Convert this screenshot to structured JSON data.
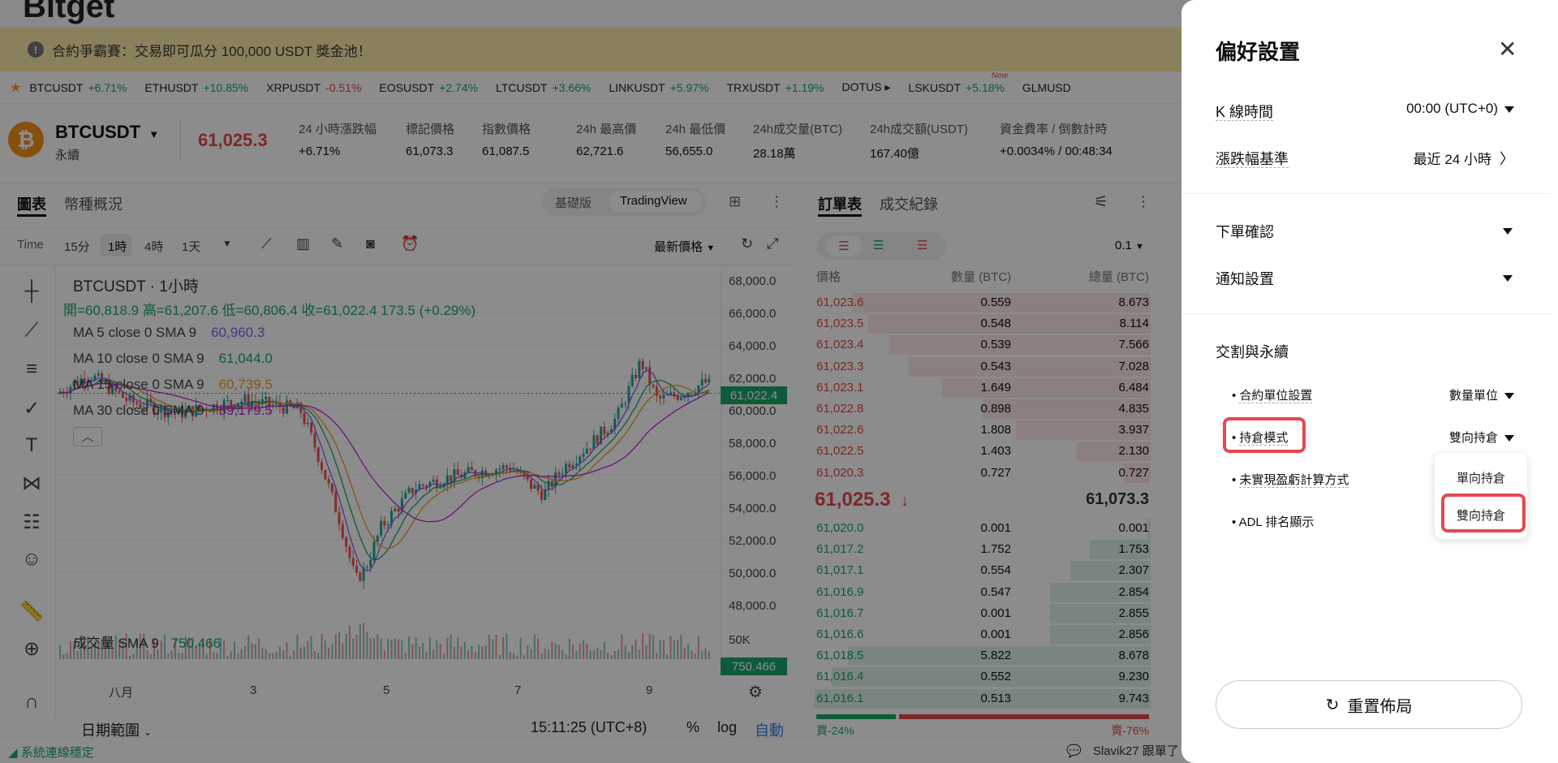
{
  "banner": {
    "text": "合約爭霸賽：交易即可瓜分 100,000 USDT 獎金池！"
  },
  "ticker": [
    {
      "pair": "BTCUSDT",
      "change": "+6.71%",
      "dir": "up"
    },
    {
      "pair": "ETHUSDT",
      "change": "+10.85%",
      "dir": "up"
    },
    {
      "pair": "XRPUSDT",
      "change": "-0.51%",
      "dir": "down"
    },
    {
      "pair": "EOSUSDT",
      "change": "+2.74%",
      "dir": "up"
    },
    {
      "pair": "LTCUSDT",
      "change": "+3.66%",
      "dir": "up"
    },
    {
      "pair": "LINKUSDT",
      "change": "+5.97%",
      "dir": "up"
    },
    {
      "pair": "TRXUSDT",
      "change": "+1.19%",
      "dir": "up"
    },
    {
      "pair": "DOTUS ▸",
      "change": "",
      "dir": "up"
    },
    {
      "pair": "LSKUSDT",
      "change": "+5.18%",
      "dir": "up",
      "tag": "New"
    },
    {
      "pair": "GLMUSD",
      "change": "",
      "dir": "up"
    }
  ],
  "header": {
    "symbol": "BTCUSDT",
    "type": "永續",
    "price": "61,025.3",
    "stats": [
      {
        "label": "24 小時漲跌幅",
        "value": "+6.71%",
        "color": "green"
      },
      {
        "label": "標記價格",
        "value": "61,073.3",
        "color": "green"
      },
      {
        "label": "指數價格",
        "value": "61,087.5",
        "color": "black"
      },
      {
        "label": "24h 最高價",
        "value": "62,721.6",
        "color": "black"
      },
      {
        "label": "24h 最低價",
        "value": "56,655.0",
        "color": "black"
      },
      {
        "label": "24h成交量(BTC)",
        "value": "28.18萬",
        "color": "black"
      },
      {
        "label": "24h成交額(USDT)",
        "value": "167.40億",
        "color": "black"
      },
      {
        "label": "資金費率 / 倒數計時",
        "value": "+0.0034%",
        "value2": "/ 00:48:34",
        "color": "green"
      }
    ]
  },
  "chart": {
    "tabs": [
      "圖表",
      "幣種概況"
    ],
    "modes": [
      "基礎版",
      "TradingView"
    ],
    "toolbar": {
      "time": "Time",
      "intervals": [
        "15分",
        "1時",
        "4時",
        "1天"
      ],
      "price_type": "最新價格"
    },
    "legend": {
      "title": "BTCUSDT · 1小時",
      "ohlc": "開=60,818.9 高=61,207.6 低=60,806.4 收=61,022.4 173.5 (+0.29%)",
      "ma": [
        {
          "label": "MA 5 close 0 SMA 9",
          "value": "60,960.3"
        },
        {
          "label": "MA 10 close 0 SMA 9",
          "value": "61,044.0"
        },
        {
          "label": "MA 15 close 0 SMA 9",
          "value": "60,739.5"
        },
        {
          "label": "MA 30 close 0 SMA 9",
          "value": "59,179.5"
        }
      ],
      "volume": "成交量 SMA 9",
      "volume_value": "750.466"
    },
    "yaxis": [
      "68,000.0",
      "66,000.0",
      "64,000.0",
      "62,000.0",
      "60,000.0",
      "58,000.0",
      "56,000.0",
      "54,000.0",
      "52,000.0",
      "50,000.0",
      "48,000.0"
    ],
    "price_tag": "61,022.4",
    "vol_axis": "50K",
    "vol_tag": "750.466",
    "xaxis": [
      "八月",
      "3",
      "5",
      "7",
      "9"
    ],
    "bottom": {
      "range": "日期範圍",
      "time": "15:11:25 (UTC+8)",
      "pct": "%",
      "log": "log",
      "auto": "自動"
    }
  },
  "orderbook": {
    "tabs": [
      "訂單表",
      "成交紀錄"
    ],
    "step": "0.1",
    "headers": [
      "價格",
      "數量 (BTC)",
      "總量 (BTC)"
    ],
    "asks": [
      {
        "price": "61,023.6",
        "qty": "0.559",
        "total": "8.673",
        "depth": 0.89
      },
      {
        "price": "61,023.5",
        "qty": "0.548",
        "total": "8.114",
        "depth": 0.84
      },
      {
        "price": "61,023.4",
        "qty": "0.539",
        "total": "7.566",
        "depth": 0.78
      },
      {
        "price": "61,023.3",
        "qty": "0.543",
        "total": "7.028",
        "depth": 0.72
      },
      {
        "price": "61,023.1",
        "qty": "1.649",
        "total": "6.484",
        "depth": 0.62
      },
      {
        "price": "61,022.8",
        "qty": "0.898",
        "total": "4.835",
        "depth": 0.5
      },
      {
        "price": "61,022.6",
        "qty": "1.808",
        "total": "3.937",
        "depth": 0.4
      },
      {
        "price": "61,022.5",
        "qty": "1.403",
        "total": "2.130",
        "depth": 0.22
      },
      {
        "price": "61,020.3",
        "qty": "0.727",
        "total": "0.727",
        "depth": 0.08
      }
    ],
    "last_price": "61,025.3",
    "last_arrow": "↓",
    "mark_price": "61,073.3",
    "bids": [
      {
        "price": "61,020.0",
        "qty": "0.001",
        "total": "0.001",
        "depth": 0.01
      },
      {
        "price": "61,017.2",
        "qty": "1.752",
        "total": "1.753",
        "depth": 0.18
      },
      {
        "price": "61,017.1",
        "qty": "0.554",
        "total": "2.307",
        "depth": 0.24
      },
      {
        "price": "61,016.9",
        "qty": "0.547",
        "total": "2.854",
        "depth": 0.3
      },
      {
        "price": "61,016.7",
        "qty": "0.001",
        "total": "2.855",
        "depth": 0.3
      },
      {
        "price": "61,016.6",
        "qty": "0.001",
        "total": "2.856",
        "depth": 0.3
      },
      {
        "price": "61,018.5",
        "qty": "5.822",
        "total": "8.678",
        "depth": 0.9
      },
      {
        "price": "61,016.4",
        "qty": "0.552",
        "total": "9.230",
        "depth": 0.95
      },
      {
        "price": "61,016.1",
        "qty": "0.513",
        "total": "9.743",
        "depth": 1.0
      }
    ],
    "buy_ratio": "買-24%",
    "sell_ratio": "賣-76%",
    "buy_share": 0.24
  },
  "status": {
    "connection": "系統連線穩定",
    "marquee": "Slavik27 跟單了"
  },
  "prefs": {
    "title": "偏好設置",
    "kline_label": "K 線時間",
    "kline_value": "00:00 (UTC+0)",
    "change_label": "漲跌幅基準",
    "change_value": "最近 24 小時",
    "order_confirm": "下單確認",
    "notify": "通知設置",
    "section": "交割與永續",
    "items": [
      {
        "label": "合約單位設置",
        "value": "數量單位"
      },
      {
        "label": "持倉模式",
        "value": "雙向持倉"
      },
      {
        "label": "未實現盈虧計算方式",
        "value": ""
      },
      {
        "label": "ADL 排名顯示",
        "value": ""
      }
    ],
    "dropdown": [
      "單向持倉",
      "雙向持倉"
    ],
    "reset": "重置佈局"
  }
}
